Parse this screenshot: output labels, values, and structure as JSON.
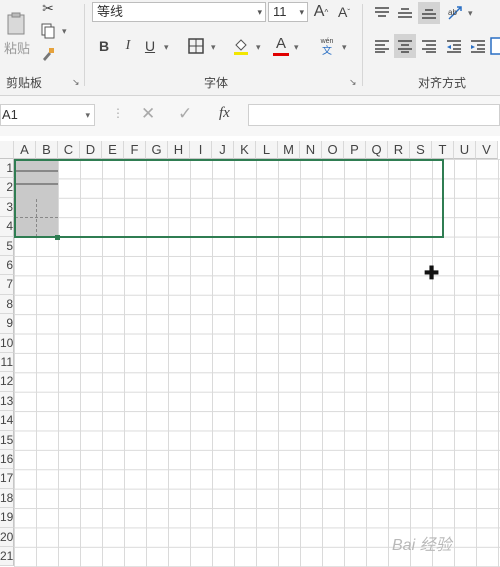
{
  "ribbon": {
    "clipboard": {
      "paste_label": "粘贴",
      "group_label": "剪贴板"
    },
    "font": {
      "font_name": "等线",
      "font_size": "11",
      "increase_font": "A",
      "decrease_font": "A",
      "bold": "B",
      "italic": "I",
      "underline": "U",
      "font_color_letter": "A",
      "phonetic_top": "wén",
      "phonetic_bottom": "文",
      "group_label": "字体",
      "font_color": "#e00000"
    },
    "alignment": {
      "group_label": "对齐方式"
    }
  },
  "formula_bar": {
    "name_box": "A1",
    "fx_label": "fx"
  },
  "columns": [
    "A",
    "B",
    "C",
    "D",
    "E",
    "F",
    "G",
    "H",
    "I",
    "J",
    "K",
    "L",
    "M",
    "N",
    "O",
    "P",
    "Q",
    "R",
    "S",
    "T",
    "U",
    "V"
  ],
  "rows": [
    "1",
    "2",
    "3",
    "4",
    "5",
    "6",
    "7",
    "8",
    "9",
    "10",
    "11",
    "12",
    "13",
    "14",
    "15",
    "16",
    "17",
    "18",
    "19",
    "20",
    "21"
  ],
  "accent_color": "#2f7d52",
  "watermark": "Bai 经验"
}
